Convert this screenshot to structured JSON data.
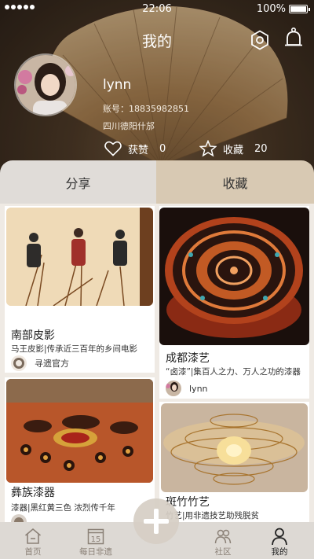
{
  "status_bar": {
    "time": "22:06",
    "battery": "100%"
  },
  "header": {
    "title": "我的",
    "settings_icon": "settings-hexagon-icon",
    "bell_icon": "bell-icon"
  },
  "profile": {
    "username": "lynn",
    "account": "账号：18835982851",
    "location": "四川德阳什邡",
    "likes_label": "获赞",
    "likes_count": "0",
    "favorites_label": "收藏",
    "favorites_count": "20"
  },
  "tabs": [
    {
      "label": "分享",
      "active": false
    },
    {
      "label": "收藏",
      "active": true
    }
  ],
  "cards": [
    {
      "title": "南部皮影",
      "desc": "马王皮影|传承近三百年的乡间电影",
      "author": "寻遗官方"
    },
    {
      "title": "成都漆艺",
      "desc": "“卤漆”|集百人之力、万人之功的漆器",
      "author": "lynn"
    },
    {
      "title": "彝族漆器",
      "desc": "漆器|黑红黄三色 浓烈传千年",
      "author": ""
    },
    {
      "title": "斑竹竹艺",
      "desc": "竹艺|用非遗技艺助残脱贫",
      "author": ""
    }
  ],
  "nav": {
    "home": "首页",
    "daily": "每日非遗",
    "daily_day": "15",
    "community": "社区",
    "mine": "我的"
  },
  "colors": {
    "tab_active": "#d8c9b3",
    "tab_inactive": "#e0dcd8",
    "nav_bg": "#ddd9d4",
    "page_bg": "#efeae4"
  }
}
